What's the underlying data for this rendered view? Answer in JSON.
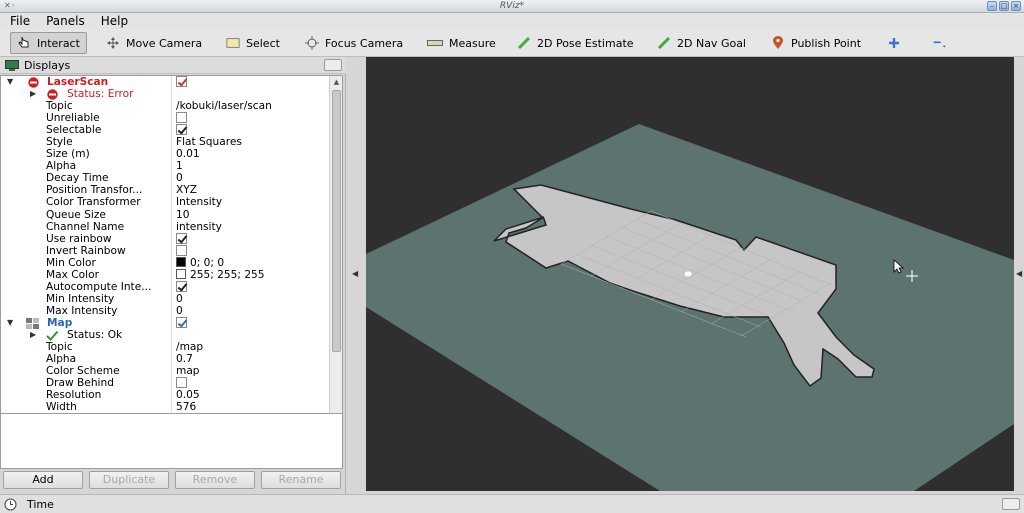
{
  "window": {
    "title": "RViz*"
  },
  "menu": [
    "File",
    "Panels",
    "Help"
  ],
  "toolbar": {
    "tools": [
      {
        "label": "Interact",
        "icon": "pointer-icon",
        "active": true
      },
      {
        "label": "Move Camera",
        "icon": "move-camera-icon"
      },
      {
        "label": "Select",
        "icon": "select-icon"
      },
      {
        "label": "Focus Camera",
        "icon": "focus-camera-icon"
      },
      {
        "label": "Measure",
        "icon": "measure-icon"
      },
      {
        "label": "2D Pose Estimate",
        "icon": "pose-estimate-icon"
      },
      {
        "label": "2D Nav Goal",
        "icon": "nav-goal-icon"
      },
      {
        "label": "Publish Point",
        "icon": "publish-point-icon"
      }
    ]
  },
  "displays": {
    "title": "Displays",
    "laserscan": {
      "name": "LaserScan",
      "status": "Status: Error",
      "props": [
        {
          "name": "Topic",
          "value": "/kobuki/laser/scan"
        },
        {
          "name": "Unreliable",
          "check": false
        },
        {
          "name": "Selectable",
          "check": true
        },
        {
          "name": "Style",
          "value": "Flat Squares"
        },
        {
          "name": "Size (m)",
          "value": "0.01"
        },
        {
          "name": "Alpha",
          "value": "1"
        },
        {
          "name": "Decay Time",
          "value": "0"
        },
        {
          "name": "Position Transfor...",
          "value": "XYZ"
        },
        {
          "name": "Color Transformer",
          "value": "Intensity"
        },
        {
          "name": "Queue Size",
          "value": "10"
        },
        {
          "name": "Channel Name",
          "value": "intensity"
        },
        {
          "name": "Use rainbow",
          "check": true
        },
        {
          "name": "Invert Rainbow",
          "check": false
        },
        {
          "name": "Min Color",
          "value": "0; 0; 0",
          "swatch": "#000000"
        },
        {
          "name": "Max Color",
          "value": "255; 255; 255",
          "swatch": "#ffffff"
        },
        {
          "name": "Autocompute Inte...",
          "check": true
        },
        {
          "name": "Min Intensity",
          "value": "0"
        },
        {
          "name": "Max Intensity",
          "value": "0"
        }
      ]
    },
    "map": {
      "name": "Map",
      "status": "Status: Ok",
      "props": [
        {
          "name": "Topic",
          "value": "/map"
        },
        {
          "name": "Alpha",
          "value": "0.7"
        },
        {
          "name": "Color Scheme",
          "value": "map"
        },
        {
          "name": "Draw Behind",
          "check": false
        },
        {
          "name": "Resolution",
          "value": "0.05"
        },
        {
          "name": "Width",
          "value": "576"
        }
      ]
    },
    "buttons": [
      {
        "label": "Add",
        "enabled": true
      },
      {
        "label": "Duplicate",
        "enabled": false
      },
      {
        "label": "Remove",
        "enabled": false
      },
      {
        "label": "Rename",
        "enabled": false
      }
    ]
  },
  "time_panel": {
    "title": "Time"
  },
  "colors": {
    "error": "#d01e1e",
    "map_name": "#2a62b8",
    "background": "#2f2f2f",
    "map_unknown": "#5d7370",
    "map_free": "#c6c6c6"
  }
}
